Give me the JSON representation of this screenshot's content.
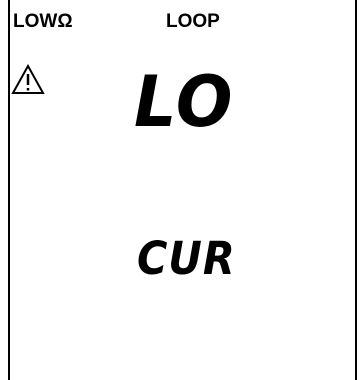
{
  "mode_labels": {
    "low_ohm": "LOWΩ",
    "loop": "LOOP"
  },
  "indicators": {
    "warning": "warning-triangle-icon"
  },
  "display": {
    "primary": "LO",
    "secondary": "CUR"
  },
  "colors": {
    "foreground": "#000000",
    "background": "#ffffff"
  }
}
